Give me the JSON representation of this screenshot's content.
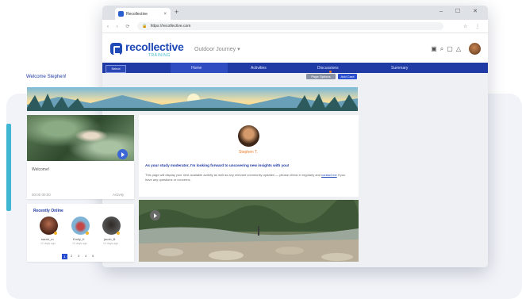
{
  "browser": {
    "tab_title": "Recollective",
    "url": "https://recollective.com",
    "new_tab": "+",
    "window_controls": "– ☐ ✕"
  },
  "header": {
    "logo_text": "recollective",
    "logo_sub": "TRAINING",
    "journey": "Outdoor Journey",
    "journey_arrow": "▾"
  },
  "nav": {
    "select_label": "Select",
    "items": [
      "Home",
      "Activities",
      "Discussions",
      "Summary"
    ]
  },
  "main": {
    "welcome": "Welcome Stephen!",
    "page_options": "Page Options",
    "add_card": "Add Card"
  },
  "video_card": {
    "title": "Welcome!",
    "meta_left": "00:00  00:00",
    "meta_right": "Activity"
  },
  "profile_card": {
    "name": "Stephen T.",
    "headline": "As your study moderator, I'm looking forward to uncovering new insights with you!",
    "body_before": "This page will display your next available activity as well as any relevant community updates — please check in regularly and ",
    "link": "contact me",
    "body_after": " if you have any questions or concerns."
  },
  "online": {
    "title": "Recently Online",
    "users": [
      {
        "name": "sarah_m",
        "time": "12 days ago"
      },
      {
        "name": "Emily_K",
        "time": "13 days ago"
      },
      {
        "name": "jacob_B",
        "time": "14 days ago"
      }
    ],
    "pages": [
      "1",
      "2",
      "3",
      "4",
      "5"
    ]
  },
  "colors": {
    "brand": "#1f49b6",
    "nav": "#1f3aa5",
    "accent": "#3fb7d2",
    "highlight": "#f07c2c"
  }
}
